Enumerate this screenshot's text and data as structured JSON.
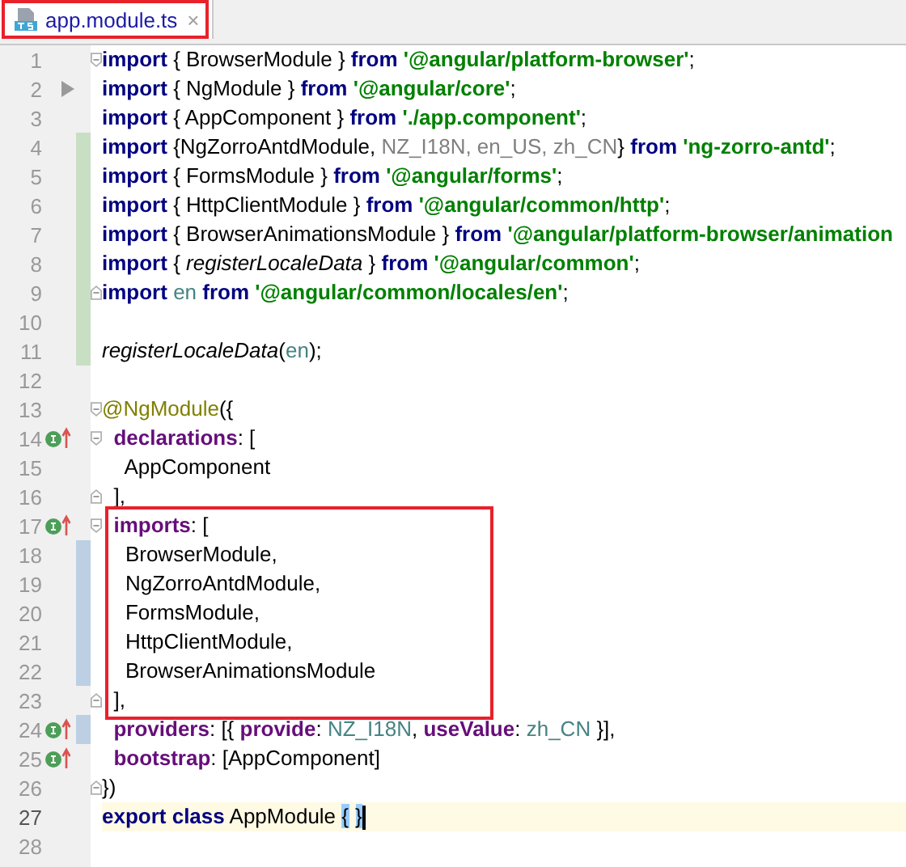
{
  "tab": {
    "title": "app.module.ts",
    "close": "×",
    "selected": true,
    "highlighted": true
  },
  "lines": [
    {
      "kind": "line",
      "number": "1",
      "fold_start": true,
      "tokens": [
        {
          "kind": "keyword",
          "text": "import"
        },
        {
          "kind": "plain",
          "text": " { BrowserModule } "
        },
        {
          "kind": "keyword",
          "text": "from"
        },
        {
          "kind": "string",
          "text": " '@angular/platform-browser'"
        },
        {
          "kind": "plain",
          "text": ";"
        }
      ]
    },
    {
      "kind": "line",
      "number": "2",
      "arrow_marker": true,
      "tokens": [
        {
          "kind": "keyword",
          "text": "import"
        },
        {
          "kind": "plain",
          "text": " { NgModule } "
        },
        {
          "kind": "keyword",
          "text": "from"
        },
        {
          "kind": "string",
          "text": " '@angular/core'"
        },
        {
          "kind": "plain",
          "text": ";"
        }
      ]
    },
    {
      "kind": "line",
      "number": "3",
      "tokens": [
        {
          "kind": "keyword",
          "text": "import"
        },
        {
          "kind": "plain",
          "text": " { AppComponent } "
        },
        {
          "kind": "keyword",
          "text": "from"
        },
        {
          "kind": "string",
          "text": " './app.component'"
        },
        {
          "kind": "plain",
          "text": ";"
        }
      ]
    },
    {
      "kind": "line",
      "number": "4",
      "added": true,
      "tokens": [
        {
          "kind": "keyword",
          "text": "import"
        },
        {
          "kind": "plain",
          "text": " {NgZorroAntdModule, "
        },
        {
          "kind": "unused",
          "text": "NZ_I18N, en_US, zh_CN"
        },
        {
          "kind": "plain",
          "text": "} "
        },
        {
          "kind": "keyword",
          "text": "from"
        },
        {
          "kind": "string",
          "text": " 'ng-zorro-antd'"
        },
        {
          "kind": "plain",
          "text": ";"
        }
      ]
    },
    {
      "kind": "line",
      "number": "5",
      "added": true,
      "tokens": [
        {
          "kind": "keyword",
          "text": "import"
        },
        {
          "kind": "plain",
          "text": " { FormsModule } "
        },
        {
          "kind": "keyword",
          "text": "from"
        },
        {
          "kind": "string",
          "text": " '@angular/forms'"
        },
        {
          "kind": "plain",
          "text": ";"
        }
      ]
    },
    {
      "kind": "line",
      "number": "6",
      "added": true,
      "tokens": [
        {
          "kind": "keyword",
          "text": "import"
        },
        {
          "kind": "plain",
          "text": " { HttpClientModule } "
        },
        {
          "kind": "keyword",
          "text": "from"
        },
        {
          "kind": "string",
          "text": " '@angular/common/http'"
        },
        {
          "kind": "plain",
          "text": ";"
        }
      ]
    },
    {
      "kind": "line",
      "number": "7",
      "added": true,
      "tokens": [
        {
          "kind": "keyword",
          "text": "import"
        },
        {
          "kind": "plain",
          "text": " { BrowserAnimationsModule } "
        },
        {
          "kind": "keyword",
          "text": "from"
        },
        {
          "kind": "string",
          "text": " '@angular/platform-browser/animation"
        }
      ]
    },
    {
      "kind": "line",
      "number": "8",
      "added": true,
      "tokens": [
        {
          "kind": "keyword",
          "text": "import"
        },
        {
          "kind": "plain",
          "text": " { "
        },
        {
          "kind": "italic",
          "text": "registerLocaleData"
        },
        {
          "kind": "plain",
          "text": " } "
        },
        {
          "kind": "keyword",
          "text": "from"
        },
        {
          "kind": "string",
          "text": " '@angular/common'"
        },
        {
          "kind": "plain",
          "text": ";"
        }
      ]
    },
    {
      "kind": "line",
      "number": "9",
      "added": true,
      "fold_end": true,
      "tokens": [
        {
          "kind": "keyword",
          "text": "import"
        },
        {
          "kind": "identifier",
          "text": " en "
        },
        {
          "kind": "keyword",
          "text": "from"
        },
        {
          "kind": "string",
          "text": " '@angular/common/locales/en'"
        },
        {
          "kind": "plain",
          "text": ";"
        }
      ]
    },
    {
      "kind": "line",
      "number": "10",
      "added": true
    },
    {
      "kind": "line",
      "number": "11",
      "added": true,
      "tokens": [
        {
          "kind": "italic",
          "text": "registerLocaleData"
        },
        {
          "kind": "plain",
          "text": "("
        },
        {
          "kind": "identifier",
          "text": "en"
        },
        {
          "kind": "plain",
          "text": ");"
        }
      ]
    },
    {
      "kind": "line",
      "number": "12"
    },
    {
      "kind": "line",
      "number": "13",
      "fold_start": true,
      "tokens": [
        {
          "kind": "decorator",
          "text": "@NgModule"
        },
        {
          "kind": "plain",
          "text": "({"
        }
      ]
    },
    {
      "kind": "line",
      "number": "14",
      "implements_marker": true,
      "fold_start": true,
      "tokens": [
        {
          "kind": "property",
          "text": "  declarations"
        },
        {
          "kind": "plain",
          "text": ": ["
        }
      ]
    },
    {
      "kind": "line",
      "number": "15",
      "tokens": [
        {
          "kind": "plain",
          "text": "    AppComponent"
        }
      ]
    },
    {
      "kind": "line",
      "number": "16",
      "fold_end": true,
      "tokens": [
        {
          "kind": "plain",
          "text": "  ],"
        }
      ]
    },
    {
      "kind": "highlight",
      "lines": [
        {
          "kind": "line",
          "number": "17",
          "implements_marker": true,
          "fold_start": true,
          "tokens": [
            {
              "kind": "property",
              "text": "  imports"
            },
            {
              "kind": "plain",
              "text": ": ["
            }
          ]
        },
        {
          "kind": "line",
          "number": "18",
          "modified": true,
          "tokens": [
            {
              "kind": "plain",
              "text": "    BrowserModule,"
            }
          ]
        },
        {
          "kind": "line",
          "number": "19",
          "modified": true,
          "tokens": [
            {
              "kind": "plain",
              "text": "    NgZorroAntdModule,"
            }
          ]
        },
        {
          "kind": "line",
          "number": "20",
          "modified": true,
          "tokens": [
            {
              "kind": "plain",
              "text": "    FormsModule,"
            }
          ]
        },
        {
          "kind": "line",
          "number": "21",
          "modified": true,
          "tokens": [
            {
              "kind": "plain",
              "text": "    HttpClientModule,"
            }
          ]
        },
        {
          "kind": "line",
          "number": "22",
          "modified": true,
          "tokens": [
            {
              "kind": "plain",
              "text": "    BrowserAnimationsModule"
            }
          ]
        },
        {
          "kind": "line",
          "number": "23",
          "fold_end": true,
          "tokens": [
            {
              "kind": "plain",
              "text": "  ],"
            }
          ]
        }
      ]
    },
    {
      "kind": "line",
      "number": "24",
      "implements_marker": true,
      "modified": true,
      "tokens": [
        {
          "kind": "property",
          "text": "  providers"
        },
        {
          "kind": "plain",
          "text": ": [{ "
        },
        {
          "kind": "property",
          "text": "provide"
        },
        {
          "kind": "plain",
          "text": ": "
        },
        {
          "kind": "identifier",
          "text": "NZ_I18N"
        },
        {
          "kind": "plain",
          "text": ", "
        },
        {
          "kind": "property",
          "text": "useValue"
        },
        {
          "kind": "plain",
          "text": ": "
        },
        {
          "kind": "identifier",
          "text": "zh_CN"
        },
        {
          "kind": "plain",
          "text": " }],"
        }
      ]
    },
    {
      "kind": "line",
      "number": "25",
      "implements_marker": true,
      "tokens": [
        {
          "kind": "property",
          "text": "  bootstrap"
        },
        {
          "kind": "plain",
          "text": ": [AppComponent]"
        }
      ]
    },
    {
      "kind": "line",
      "number": "26",
      "fold_end": true,
      "tokens": [
        {
          "kind": "plain",
          "text": "})"
        }
      ]
    },
    {
      "kind": "line",
      "number": "27",
      "current": true,
      "caret": true,
      "tokens": [
        {
          "kind": "keyword",
          "text": "export class"
        },
        {
          "kind": "plain",
          "text": " AppModule "
        },
        {
          "kind": "brace-match",
          "text": "{"
        },
        {
          "kind": "brace-match",
          "text": "}"
        }
      ]
    },
    {
      "kind": "line",
      "number": "28"
    }
  ]
}
